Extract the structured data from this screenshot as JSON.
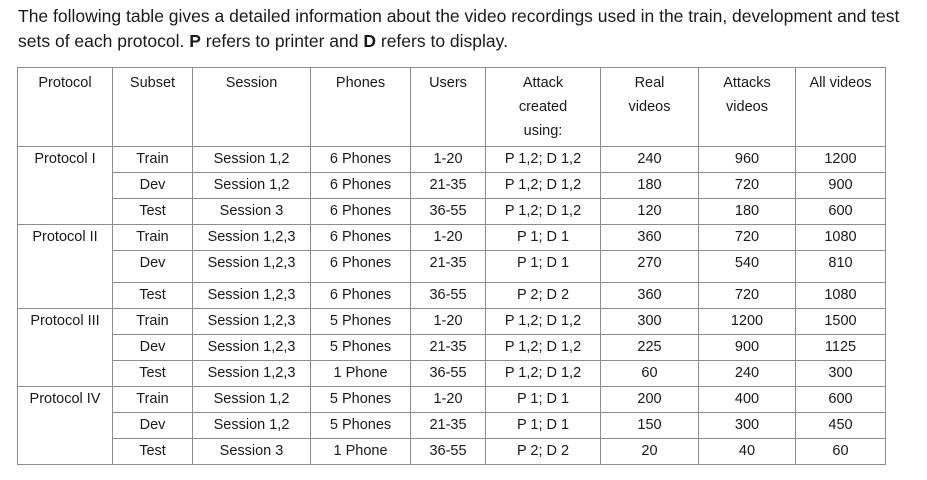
{
  "intro": {
    "line1_pre": "The following table gives a detailed information about the video recordings used in the train, development and test sets of each protocol. ",
    "p_letter": "P",
    "mid": " refers to printer and ",
    "d_letter": "D",
    "end": " refers to display."
  },
  "table": {
    "headers": {
      "protocol": "Protocol",
      "subset": "Subset",
      "session": "Session",
      "phones": "Phones",
      "users": "Users",
      "attack_l1": "Attack",
      "attack_l2": "created",
      "attack_l3": "using:",
      "real_l1": "Real",
      "real_l2": "videos",
      "attacks_l1": "Attacks",
      "attacks_l2": "videos",
      "all": "All videos"
    },
    "rows": [
      {
        "protocol": "Protocol I",
        "subset": "Train",
        "session": "Session 1,2",
        "phones": "6 Phones",
        "users": "1-20",
        "attack": "P 1,2; D 1,2",
        "real": "240",
        "attacks": "960",
        "all": "1200"
      },
      {
        "protocol": "",
        "subset": "Dev",
        "session": "Session 1,2",
        "phones": "6 Phones",
        "users": "21-35",
        "attack": "P 1,2; D 1,2",
        "real": "180",
        "attacks": "720",
        "all": "900"
      },
      {
        "protocol": "",
        "subset": "Test",
        "session": "Session 3",
        "phones": "6 Phones",
        "users": "36-55",
        "attack": "P 1,2; D 1,2",
        "real": "120",
        "attacks": "180",
        "all": "600"
      },
      {
        "protocol": "Protocol II",
        "subset": "Train",
        "session": "Session 1,2,3",
        "phones": "6 Phones",
        "users": "1-20",
        "attack": "P 1; D 1",
        "real": "360",
        "attacks": "720",
        "all": "1080"
      },
      {
        "protocol": "",
        "subset": "Dev",
        "session": "Session 1,2,3",
        "phones": "6 Phones",
        "users": "21-35",
        "attack": "P 1; D 1",
        "real": "270",
        "attacks": "540",
        "all": "810"
      },
      {
        "protocol": "",
        "subset": "Test",
        "session": "Session 1,2,3",
        "phones": "6 Phones",
        "users": "36-55",
        "attack": "P 2; D 2",
        "real": "360",
        "attacks": "720",
        "all": "1080"
      },
      {
        "protocol": "Protocol III",
        "subset": "Train",
        "session": "Session 1,2,3",
        "phones": "5 Phones",
        "users": "1-20",
        "attack": "P 1,2; D 1,2",
        "real": "300",
        "attacks": "1200",
        "all": "1500"
      },
      {
        "protocol": "",
        "subset": "Dev",
        "session": "Session 1,2,3",
        "phones": "5 Phones",
        "users": "21-35",
        "attack": "P 1,2; D 1,2",
        "real": "225",
        "attacks": "900",
        "all": "1125"
      },
      {
        "protocol": "",
        "subset": "Test",
        "session": "Session 1,2,3",
        "phones": "1 Phone",
        "users": "36-55",
        "attack": "P 1,2; D 1,2",
        "real": "60",
        "attacks": "240",
        "all": "300"
      },
      {
        "protocol": "Protocol IV",
        "subset": "Train",
        "session": "Session 1,2",
        "phones": "5 Phones",
        "users": "1-20",
        "attack": "P 1; D 1",
        "real": "200",
        "attacks": "400",
        "all": "600"
      },
      {
        "protocol": "",
        "subset": "Dev",
        "session": "Session 1,2",
        "phones": "5 Phones",
        "users": "21-35",
        "attack": "P 1; D 1",
        "real": "150",
        "attacks": "300",
        "all": "450"
      },
      {
        "protocol": "",
        "subset": "Test",
        "session": "Session 3",
        "phones": "1 Phone",
        "users": "36-55",
        "attack": "P 2; D 2",
        "real": "20",
        "attacks": "40",
        "all": "60"
      }
    ]
  }
}
